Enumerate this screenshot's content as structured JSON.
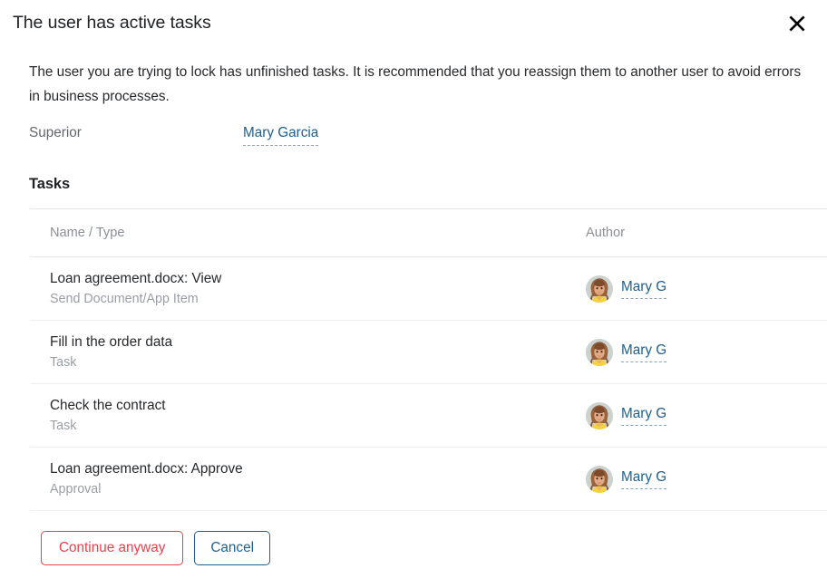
{
  "dialog": {
    "title": "The user has active tasks",
    "close_icon": "close-icon",
    "description": "The user you are trying to lock has unfinished tasks. It is recommended that you reassign them to another user to avoid errors in business processes.",
    "superior": {
      "label": "Superior",
      "value": "Mary Garcia"
    },
    "section_title": "Tasks",
    "table": {
      "columns": [
        "Name / Type",
        "Author"
      ],
      "rows": [
        {
          "name": "Loan agreement.docx: View",
          "type": "Send Document/App Item",
          "author": "Mary G",
          "avatar": "avatar-mary-garcia"
        },
        {
          "name": "Fill in the order data",
          "type": "Task",
          "author": "Mary G",
          "avatar": "avatar-mary-garcia"
        },
        {
          "name": "Check the contract",
          "type": "Task",
          "author": "Mary G",
          "avatar": "avatar-mary-garcia"
        },
        {
          "name": "Loan agreement.docx: Approve",
          "type": "Approval",
          "author": "Mary G",
          "avatar": "avatar-mary-garcia"
        }
      ]
    },
    "footer": {
      "continue_label": "Continue anyway",
      "cancel_label": "Cancel"
    },
    "colors": {
      "danger": "#ea3f4c",
      "link": "#20608f",
      "text": "#26282b",
      "muted": "#9a9ea4",
      "divider": "#eceef0"
    }
  }
}
